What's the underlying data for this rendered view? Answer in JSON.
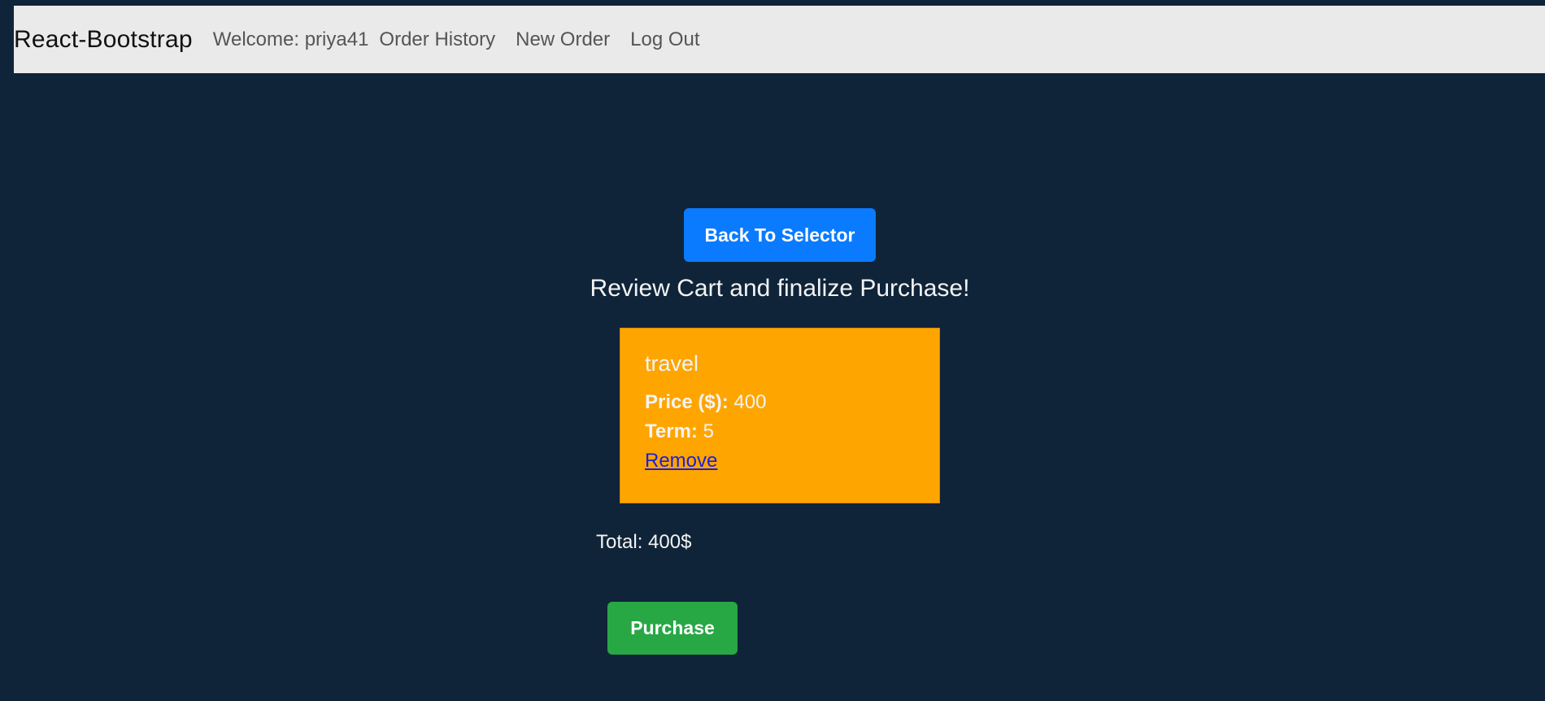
{
  "navbar": {
    "brand": "React-Bootstrap",
    "welcome": "Welcome: priya41",
    "links": {
      "order_history": "Order History",
      "new_order": "New Order",
      "log_out": "Log Out"
    }
  },
  "main": {
    "back_button": "Back To Selector",
    "heading": "Review Cart and finalize Purchase!",
    "cart_items": [
      {
        "title": "travel",
        "price_label": "Price ($):",
        "price_value": " 400",
        "term_label": "Term:",
        "term_value": " 5",
        "remove_label": "Remove"
      }
    ],
    "total_text": "Total: 400$",
    "purchase_button": "Purchase"
  },
  "colors": {
    "page_background": "#0f2439",
    "navbar_background": "#eaeaea",
    "primary_button": "#0a7bff",
    "card_background": "#ffa500",
    "success_button": "#28a745",
    "link": "#1f1fd6"
  }
}
